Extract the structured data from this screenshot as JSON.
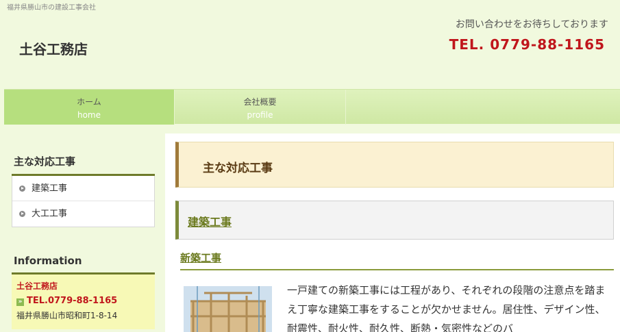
{
  "header": {
    "tagline": "福井県勝山市の建設工事会社",
    "site_title": "土谷工務店",
    "contact_message": "お問い合わせをお待ちしております",
    "contact_tel": "TEL. 0779-88-1165"
  },
  "nav": {
    "items": [
      {
        "label_ja": "ホーム",
        "label_en": "home"
      },
      {
        "label_ja": "会社概要",
        "label_en": "profile"
      }
    ]
  },
  "sidebar": {
    "heading": "主な対応工事",
    "items": [
      {
        "label": "建築工事"
      },
      {
        "label": "大工工事"
      }
    ],
    "info_heading": "Information",
    "info": {
      "name": "土谷工務店",
      "tel": "TEL.0779-88-1165",
      "address": "福井県勝山市昭和町1-8-14"
    }
  },
  "main": {
    "page_title": "主な対応工事",
    "section_title": "建築工事",
    "sub_title": "新築工事",
    "body_text": "一戸建ての新築工事には工程があり、それぞれの段階の注意点を踏まえ丁寧な建築工事をすることが欠かせません。居住性、デザイン性、耐震性、耐火性、耐久性、断熱・気密性などのバ"
  },
  "colors": {
    "background": "#f1f9de",
    "accent_red": "#c0161c",
    "nav_active": "#b6df7e",
    "olive": "#6b7a1e"
  }
}
